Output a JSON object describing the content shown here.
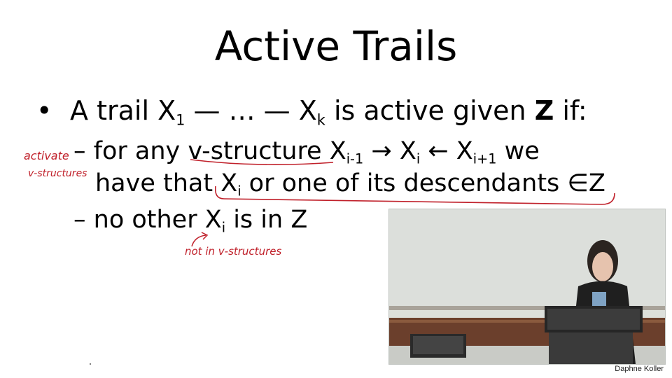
{
  "slide": {
    "title": "Active Trails",
    "bullet": {
      "marker": "•",
      "text_a": "A trail X",
      "sub_1": "1",
      "text_b": " — … — X",
      "sub_k": "k",
      "text_c": " is active given ",
      "bold_z": "Z",
      "text_d": " if:"
    },
    "sub1": {
      "dash": "– ",
      "text_a": "for any v-structure X",
      "sub_a": "i-1",
      "arrow_r": " → X",
      "sub_b": "i",
      "arrow_l": " ← X",
      "sub_c": "i+1",
      "text_b": "  we"
    },
    "sub2": {
      "text_a": "have that X",
      "sub_a": "i",
      "text_b": " or one of its descendants ∈Z"
    },
    "sub3": {
      "dash": "– ",
      "text_a": "no other X",
      "sub_a": "i",
      "text_b": " is in Z"
    }
  },
  "annotations": {
    "note_activate": "activate",
    "note_vstructures": "v-structures",
    "note_not_in": "not in v-structures",
    "ink_color": "#c0202a"
  },
  "video": {
    "credit": "Daphne Koller"
  }
}
